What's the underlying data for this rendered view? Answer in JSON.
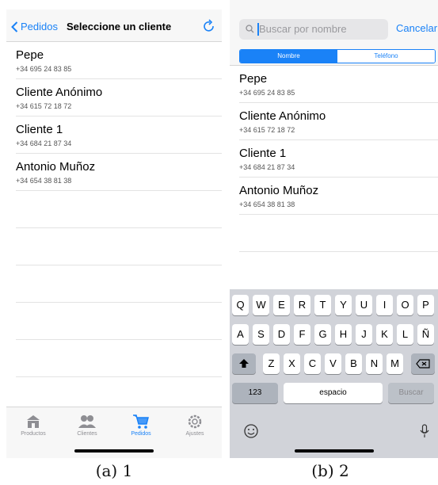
{
  "panel1": {
    "back_label": "Pedidos",
    "title": "Seleccione un cliente",
    "icons": {
      "back": "chevron-left-icon",
      "refresh": "refresh-icon"
    },
    "clients": [
      {
        "name": "Pepe",
        "phone": "+34 695 24 83 85"
      },
      {
        "name": "Cliente Anónimo",
        "phone": "+34 615 72 18 72"
      },
      {
        "name": "Cliente 1",
        "phone": "+34 684 21 87 34"
      },
      {
        "name": "Antonio Muñoz",
        "phone": "+34 654 38 81 38"
      }
    ],
    "tabs": [
      {
        "label": "Productos",
        "icon": "store-icon"
      },
      {
        "label": "Clientes",
        "icon": "people-icon"
      },
      {
        "label": "Pedidos",
        "icon": "cart-icon",
        "active": true
      },
      {
        "label": "Ajustes",
        "icon": "gear-icon"
      }
    ],
    "caption": "(a) 1"
  },
  "panel2": {
    "search_placeholder": "Buscar por nombre",
    "cancel_label": "Cancelar",
    "segments": [
      "Nombre",
      "Teléfono"
    ],
    "selected_segment": "Nombre",
    "clients": [
      {
        "name": "Pepe",
        "phone": "+34 695 24 83 85"
      },
      {
        "name": "Cliente Anónimo",
        "phone": "+34 615 72 18 72"
      },
      {
        "name": "Cliente 1",
        "phone": "+34 684 21 87 34"
      },
      {
        "name": "Antonio Muñoz",
        "phone": "+34 654 38 81 38"
      }
    ],
    "keyboard": {
      "row1": [
        "Q",
        "W",
        "E",
        "R",
        "T",
        "Y",
        "U",
        "I",
        "O",
        "P"
      ],
      "row2": [
        "A",
        "S",
        "D",
        "F",
        "G",
        "H",
        "J",
        "K",
        "L",
        "Ñ"
      ],
      "row3": [
        "Z",
        "X",
        "C",
        "V",
        "B",
        "N",
        "M"
      ],
      "numbers_key": "123",
      "space_key": "espacio",
      "search_key": "Buscar"
    },
    "caption": "(b) 2"
  },
  "colors": {
    "accent": "#1a82f7",
    "keyboard_bg": "#d1d3d9"
  }
}
